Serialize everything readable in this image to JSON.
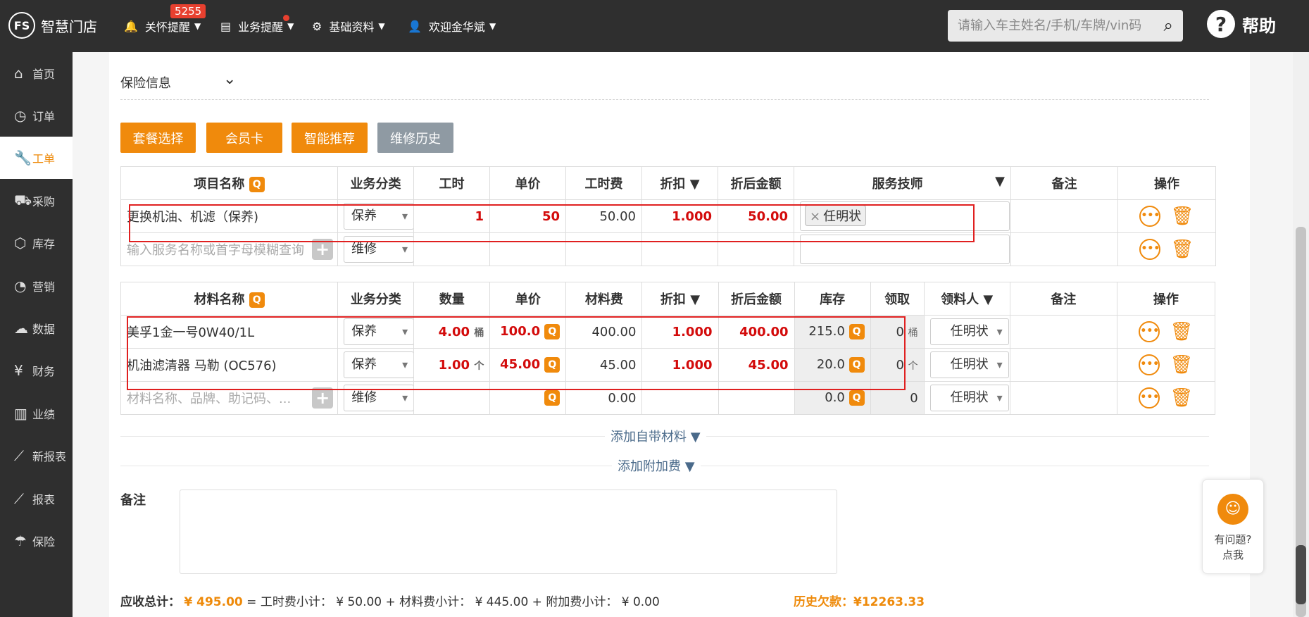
{
  "header": {
    "logo_text": "智慧门店",
    "logo_mark": "FS",
    "nav": [
      {
        "label": "关怀提醒",
        "icon": "bell-icon",
        "badge": "5255"
      },
      {
        "label": "业务提醒",
        "icon": "document-icon"
      },
      {
        "label": "基础资料",
        "icon": "gear-icon"
      },
      {
        "label": "欢迎金华斌",
        "icon": "user-icon"
      }
    ],
    "search_placeholder": "请输入车主姓名/手机/车牌/vin码",
    "help_label": "帮助",
    "help_icon": "?"
  },
  "sidebar": {
    "items": [
      {
        "label": "首页",
        "icon": "home-icon",
        "glyph": "⌂"
      },
      {
        "label": "订单",
        "icon": "history-icon",
        "glyph": "◷"
      },
      {
        "label": "工单",
        "icon": "wrench-icon",
        "glyph": "🔧",
        "active": true
      },
      {
        "label": "采购",
        "icon": "cart-icon",
        "glyph": "⛟"
      },
      {
        "label": "库存",
        "icon": "box-icon",
        "glyph": "⬡"
      },
      {
        "label": "营销",
        "icon": "pie-icon",
        "glyph": "◔"
      },
      {
        "label": "数据",
        "icon": "cloud-icon",
        "glyph": "☁"
      },
      {
        "label": "财务",
        "icon": "yen-icon",
        "glyph": "¥"
      },
      {
        "label": "业绩",
        "icon": "bar-chart-icon",
        "glyph": "▥"
      },
      {
        "label": "新报表",
        "icon": "line-chart-icon",
        "glyph": "⟋"
      },
      {
        "label": "报表",
        "icon": "trend-icon",
        "glyph": "⟋"
      },
      {
        "label": "保险",
        "icon": "umbrella-icon",
        "glyph": "☂"
      }
    ]
  },
  "insurance": {
    "label": "保险信息"
  },
  "buttons": [
    "套餐选择",
    "会员卡",
    "智能推荐",
    "维修历史"
  ],
  "service_table": {
    "headers": [
      "项目名称",
      "业务分类",
      "工时",
      "单价",
      "工时费",
      "折扣",
      "折后金额",
      "服务技师",
      "备注",
      "操作"
    ],
    "rows": [
      {
        "name": "更换机油、机滤（保养)",
        "category": "保养",
        "hours": "1",
        "price": "50",
        "fee": "50.00",
        "discount": "1.000",
        "amount": "50.00",
        "tech": "任明状"
      }
    ],
    "new_row": {
      "placeholder": "输入服务名称或首字母模糊查询",
      "category": "维修"
    }
  },
  "material_table": {
    "headers": [
      "材料名称",
      "业务分类",
      "数量",
      "单价",
      "材料费",
      "折扣",
      "折后金额",
      "库存",
      "领取",
      "领料人",
      "备注",
      "操作"
    ],
    "rows": [
      {
        "name": "美孚1金一号0W40/1L",
        "category": "保养",
        "qty": "4.00",
        "unit": "桶",
        "price": "100.0",
        "fee": "400.00",
        "discount": "1.000",
        "amount": "400.00",
        "stock": "215.0",
        "taken": "0",
        "taken_unit": "桶",
        "receiver": "任明状"
      },
      {
        "name": "机油滤清器 马勒 (OC576)",
        "category": "保养",
        "qty": "1.00",
        "unit": "个",
        "price": "45.00",
        "fee": "45.00",
        "discount": "1.000",
        "amount": "45.00",
        "stock": "20.0",
        "taken": "0",
        "taken_unit": "个",
        "receiver": "任明状"
      }
    ],
    "new_row": {
      "placeholder": "材料名称、品牌、助记码、...",
      "category": "维修",
      "fee": "0.00",
      "stock": "0.0",
      "taken": "0",
      "receiver": "任明状"
    }
  },
  "links": {
    "self_material": "添加自带材料 ▼",
    "extra_fee": "添加附加费 ▼"
  },
  "remark_label": "备注",
  "totals": {
    "label": "应收总计：",
    "amount": "¥ 495.00",
    "rest": "= 工时费小计： ¥ 50.00 + 材料费小计： ¥ 445.00 + 附加费小计： ¥ 0.00",
    "debt": "历史欠款：¥12263.33"
  },
  "chat": {
    "line1": "有问题?",
    "line2": "点我"
  },
  "colors": {
    "accent": "#f08a0c",
    "danger": "#d30b0b",
    "topbar": "#2f2f2f"
  }
}
